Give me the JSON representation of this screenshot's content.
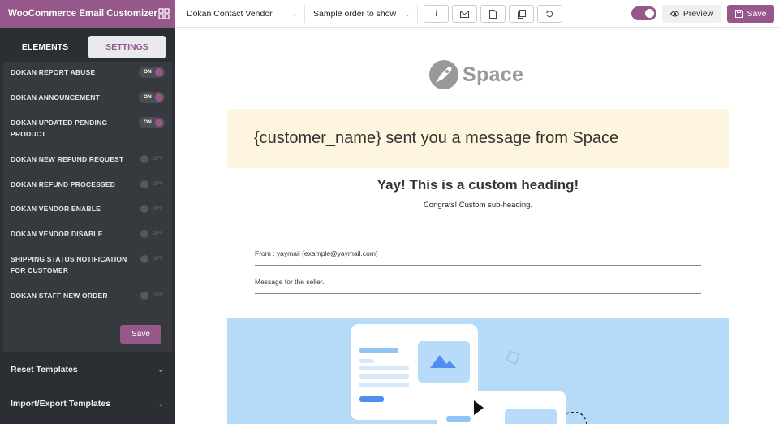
{
  "app": {
    "title": "WooCommerce Email Customizer"
  },
  "sidebar": {
    "tabs": [
      {
        "label": "ELEMENTS",
        "active": false
      },
      {
        "label": "SETTINGS",
        "active": true
      }
    ],
    "toggles": [
      {
        "label": "DOKAN REPORT ABUSE",
        "state": "ON"
      },
      {
        "label": "DOKAN ANNOUNCEMENT",
        "state": "ON"
      },
      {
        "label": "DOKAN UPDATED PENDING PRODUCT",
        "state": "ON"
      },
      {
        "label": "DOKAN NEW REFUND REQUEST",
        "state": "OFF"
      },
      {
        "label": "DOKAN REFUND PROCESSED",
        "state": "OFF"
      },
      {
        "label": "DOKAN VENDOR ENABLE",
        "state": "OFF"
      },
      {
        "label": "DOKAN VENDOR DISABLE",
        "state": "OFF"
      },
      {
        "label": "SHIPPING STATUS NOTIFICATION FOR CUSTOMER",
        "state": "OFF"
      },
      {
        "label": "DOKAN STAFF NEW ORDER",
        "state": "OFF"
      }
    ],
    "save_label": "Save",
    "accordions": [
      {
        "label": "Reset Templates"
      },
      {
        "label": "Import/Export Templates"
      }
    ]
  },
  "topbar": {
    "template_select": "Dokan Contact Vendor",
    "order_select": "Sample order to show",
    "info_label": "i",
    "preview_label": "Preview",
    "save_label": "Save"
  },
  "email": {
    "logo_text": "Space",
    "banner_text": "{customer_name} sent you a message from Space",
    "heading": "Yay! This is a custom heading!",
    "subheading": "Congrats! Custom sub-heading.",
    "from_line": "From : yaymail (example@yaymail.com)",
    "message_line": "Message for the seller."
  },
  "colors": {
    "brand": "#96588a",
    "sidebar_bg": "#2b2f33",
    "banner_bg": "#fdf5dd",
    "hero_bg": "#b6dbf9"
  }
}
